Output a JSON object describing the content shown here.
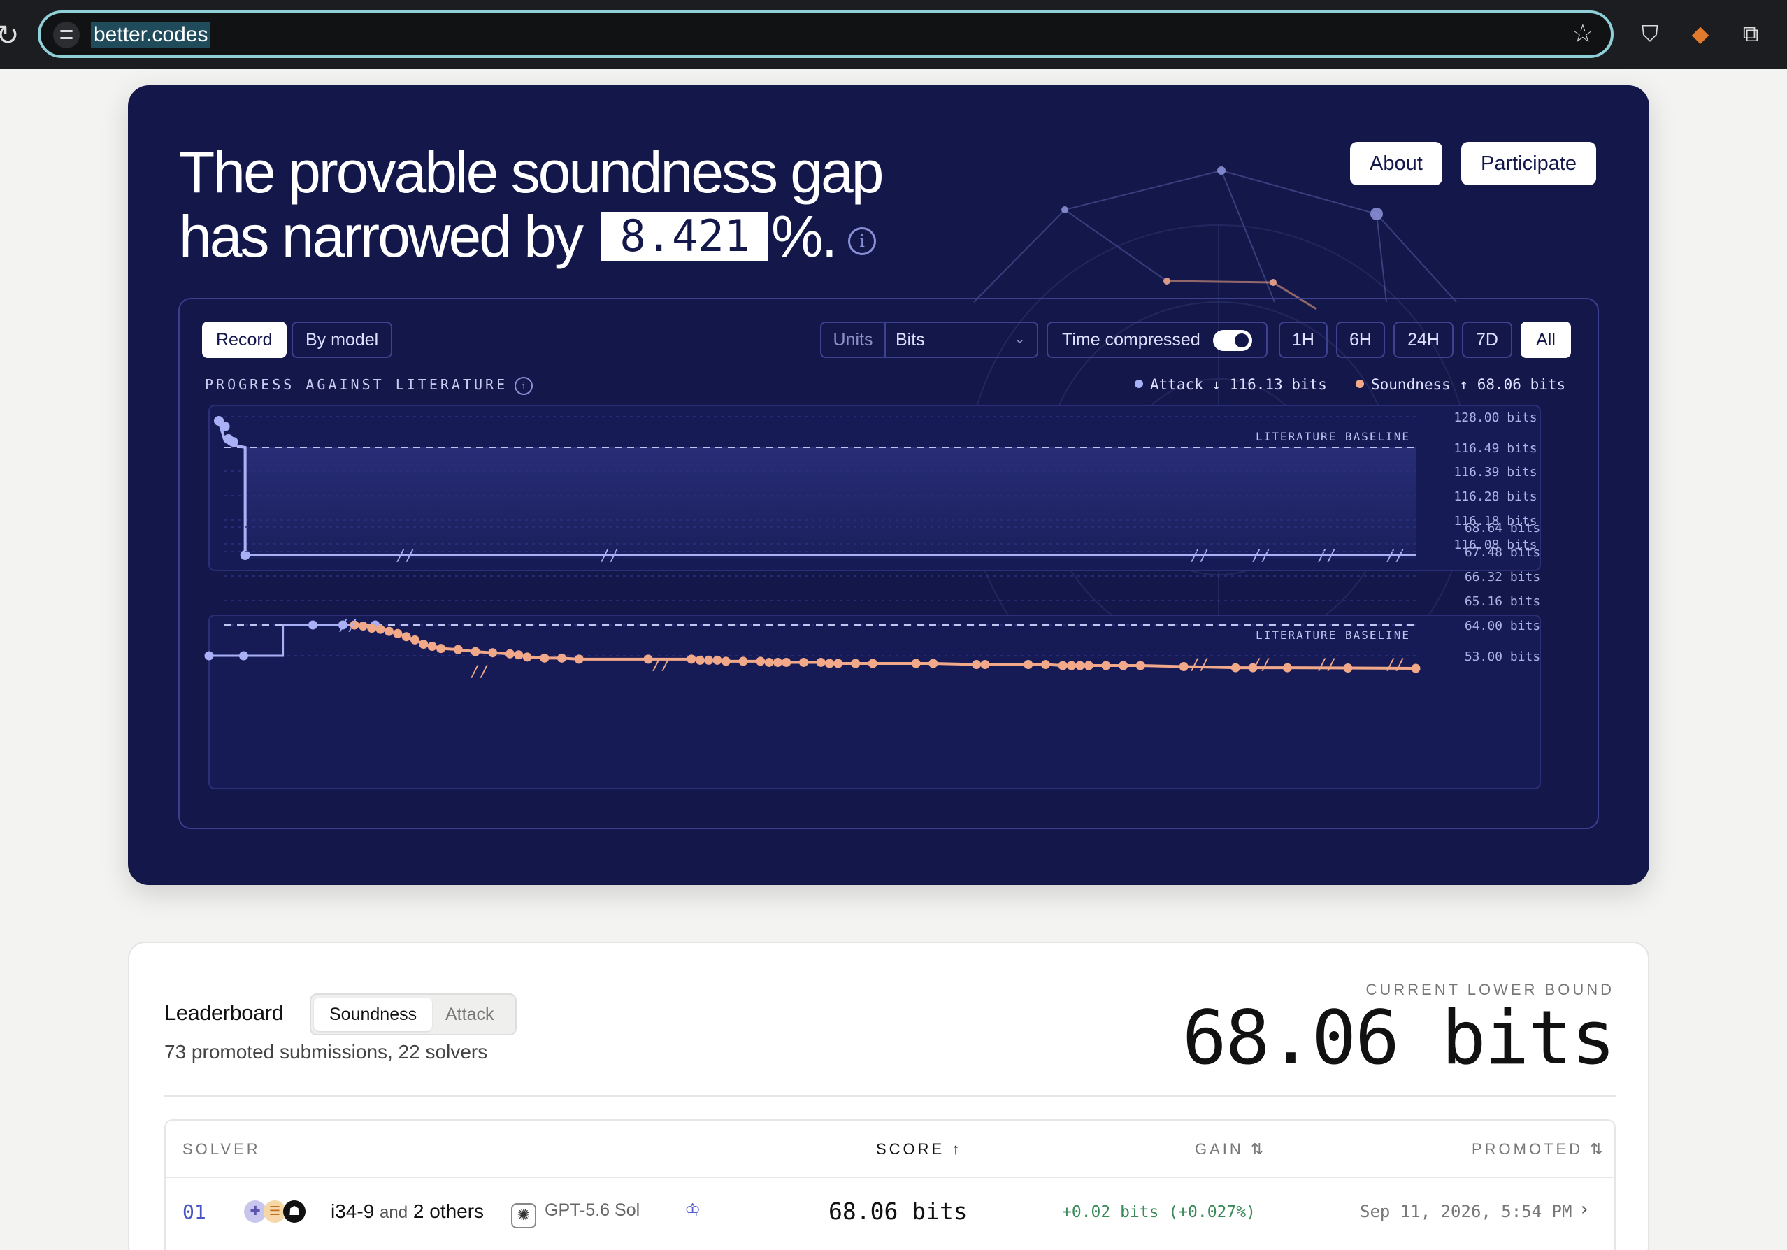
{
  "browser": {
    "url": "better.codes",
    "reload_icon": "reload-icon",
    "star_icon": "star-icon"
  },
  "hero": {
    "headline_line1": "The provable soundness gap",
    "headline_line2_prefix": "has narrowed by",
    "headline_value": "8.421",
    "headline_suffix": "%.",
    "info_glyph": "i",
    "about_label": "About",
    "participate_label": "Participate"
  },
  "controls": {
    "record_label": "Record",
    "by_model_label": "By model",
    "units_label": "Units",
    "units_value": "Bits",
    "time_compressed_label": "Time compressed",
    "time_compressed_on": true,
    "ranges": [
      "1H",
      "6H",
      "24H",
      "7D",
      "All"
    ],
    "active_range": "All"
  },
  "chart_header": {
    "progress_label": "PROGRESS AGAINST LITERATURE",
    "attack_legend": "Attack ↓ 116.13 bits",
    "soundness_legend": "Soundness ↑ 68.06 bits"
  },
  "colors": {
    "panel_bg": "#13174a",
    "attack": "#a9b0f5",
    "soundness": "#f2a98a"
  },
  "chart_data": [
    {
      "type": "line",
      "name": "Attack",
      "ylim": [
        116.03,
        128.0
      ],
      "y_ticks": [
        "128.00 bits",
        "116.49 bits",
        "116.39 bits",
        "116.28 bits",
        "116.18 bits",
        "116.08 bits"
      ],
      "baseline_label": "LITERATURE BASELINE",
      "baseline_value": 116.49,
      "x": [
        0,
        1,
        2,
        3,
        100
      ],
      "values": [
        128.0,
        116.6,
        116.5,
        116.13,
        116.13
      ]
    },
    {
      "type": "line",
      "name": "Soundness",
      "ylim": [
        53.0,
        68.64
      ],
      "y_ticks": [
        "68.64 bits",
        "67.48 bits",
        "66.32 bits",
        "65.16 bits",
        "64.00 bits",
        "53.00 bits"
      ],
      "baseline_label": "LITERATURE BASELINE",
      "baseline_value": 64.0,
      "prebaseline_x": [
        0,
        1.5,
        4.5,
        5.8,
        7.2
      ],
      "prebaseline_values": [
        53.0,
        53.0,
        64.0,
        64.0,
        64.0
      ],
      "x": [
        14,
        14.7,
        15.4,
        16.1,
        16.8,
        17.5,
        18.2,
        18.9,
        19.6,
        20.3,
        21.0,
        22.4,
        23.8,
        25.2,
        26.6,
        27.3,
        28.0,
        29.4,
        30.8,
        32.2,
        37.8,
        41.3,
        42.0,
        42.7,
        43.4,
        44.1,
        45.5,
        46.9,
        47.6,
        48.3,
        49.0,
        50.4,
        51.8,
        52.5,
        53.2,
        54.6,
        56.0,
        59.5,
        60.9,
        64.4,
        65.1,
        68.6,
        70.0,
        71.4,
        72.1,
        72.8,
        73.5,
        74.9,
        76.3,
        77.7,
        81.2,
        85.4,
        86.8,
        89.6,
        94.5,
        100
      ],
      "values": [
        64.0,
        64.1,
        64.3,
        64.4,
        64.6,
        64.8,
        65.1,
        65.4,
        65.8,
        66.0,
        66.2,
        66.3,
        66.5,
        66.6,
        66.7,
        66.8,
        67.0,
        67.1,
        67.1,
        67.2,
        67.2,
        67.2,
        67.3,
        67.3,
        67.3,
        67.4,
        67.4,
        67.4,
        67.5,
        67.5,
        67.5,
        67.5,
        67.5,
        67.6,
        67.6,
        67.6,
        67.6,
        67.6,
        67.6,
        67.7,
        67.7,
        67.7,
        67.7,
        67.8,
        67.8,
        67.8,
        67.8,
        67.8,
        67.8,
        67.8,
        67.9,
        68.0,
        68.0,
        68.0,
        68.03,
        68.06
      ]
    }
  ],
  "leaderboard": {
    "title": "Leaderboard",
    "tab_soundness": "Soundness",
    "tab_attack": "Attack",
    "subtitle": "73 promoted submissions, 22 solvers",
    "bound_label": "CURRENT LOWER BOUND",
    "bound_value": "68.06 bits",
    "columns": {
      "solver": "SOLVER",
      "score": "SCORE ↑",
      "gain": "GAIN ⇅",
      "promoted": "PROMOTED ⇅"
    },
    "rows": [
      {
        "rank": "01",
        "solver": "i34-9",
        "and_text": "and",
        "others": "2 others",
        "model": "GPT-5.6 Sol",
        "score": "68.06 bits",
        "gain": "+0.02 bits (+0.027%)",
        "promoted": "Sep 11, 2026, 5:54 PM"
      }
    ]
  }
}
